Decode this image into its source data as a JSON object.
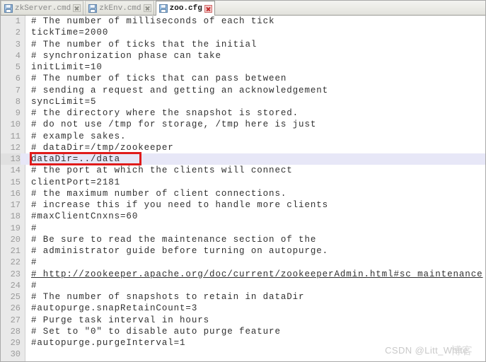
{
  "window": {
    "title": "zoo.cfg",
    "app_kind": "text-editor"
  },
  "tabs": [
    {
      "label": "zkServer.cmd",
      "icon": "save-floppy-icon",
      "close_icon": "close-icon",
      "active": false
    },
    {
      "label": "zkEnv.cmd",
      "icon": "save-floppy-icon",
      "close_icon": "close-icon",
      "active": false
    },
    {
      "label": "zoo.cfg",
      "icon": "save-floppy-icon",
      "close_icon": "close-icon",
      "active": true
    }
  ],
  "editor": {
    "gutter_color": "#e9e9e9",
    "highlight_color": "#e7e7f7",
    "annotation_color": "#e01b1b",
    "highlighted_line": 13,
    "lines": [
      {
        "n": "1",
        "text": "# The number of milliseconds of each tick"
      },
      {
        "n": "2",
        "text": "tickTime=2000"
      },
      {
        "n": "3",
        "text": "# The number of ticks that the initial"
      },
      {
        "n": "4",
        "text": "# synchronization phase can take"
      },
      {
        "n": "5",
        "text": "initLimit=10"
      },
      {
        "n": "6",
        "text": "# The number of ticks that can pass between"
      },
      {
        "n": "7",
        "text": "# sending a request and getting an acknowledgement"
      },
      {
        "n": "8",
        "text": "syncLimit=5"
      },
      {
        "n": "9",
        "text": "# the directory where the snapshot is stored."
      },
      {
        "n": "10",
        "text": "# do not use /tmp for storage, /tmp here is just"
      },
      {
        "n": "11",
        "text": "# example sakes."
      },
      {
        "n": "12",
        "text": "# dataDir=/tmp/zookeeper"
      },
      {
        "n": "13",
        "text": "dataDir=../data"
      },
      {
        "n": "14",
        "text": "# the port at which the clients will connect"
      },
      {
        "n": "15",
        "text": "clientPort=2181"
      },
      {
        "n": "16",
        "text": "# the maximum number of client connections."
      },
      {
        "n": "17",
        "text": "# increase this if you need to handle more clients"
      },
      {
        "n": "18",
        "text": "#maxClientCnxns=60"
      },
      {
        "n": "19",
        "text": "#"
      },
      {
        "n": "20",
        "text": "# Be sure to read the maintenance section of the"
      },
      {
        "n": "21",
        "text": "# administrator guide before turning on autopurge."
      },
      {
        "n": "22",
        "text": "#"
      },
      {
        "n": "23",
        "text": "# http://zookeeper.apache.org/doc/current/zookeeperAdmin.html#sc_maintenance",
        "link": true
      },
      {
        "n": "24",
        "text": "#"
      },
      {
        "n": "25",
        "text": "# The number of snapshots to retain in dataDir"
      },
      {
        "n": "26",
        "text": "#autopurge.snapRetainCount=3"
      },
      {
        "n": "27",
        "text": "# Purge task interval in hours"
      },
      {
        "n": "28",
        "text": "# Set to \"0\" to disable auto purge feature"
      },
      {
        "n": "29",
        "text": "#autopurge.purgeInterval=1"
      },
      {
        "n": "30",
        "text": ""
      }
    ]
  },
  "watermark": {
    "text": "CSDN @Litt_White",
    "overlay_text": "博客"
  }
}
